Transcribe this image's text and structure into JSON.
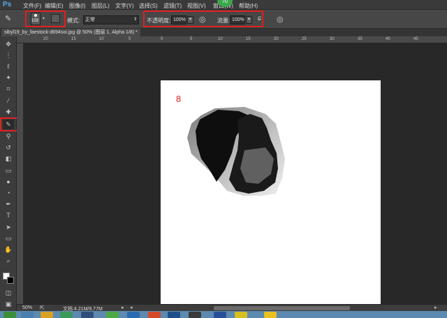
{
  "app": {
    "logo": "Ps"
  },
  "menubar": {
    "items": [
      "文件(F)",
      "编辑(E)",
      "图像(I)",
      "图层(L)",
      "文字(Y)",
      "选择(S)",
      "滤镜(T)",
      "视图(V)",
      "窗口(W)",
      "帮助(H)"
    ],
    "badge": "70"
  },
  "options": {
    "brush_size": "103",
    "mode_label": "模式:",
    "mode_value": "正常",
    "opacity_label": "不透明度:",
    "opacity_value": "100%",
    "flow_label": "流量:",
    "flow_value": "100%"
  },
  "document": {
    "tab_title": "sibyl19_by_faestock-d694soi.jpg @ 50% (图层 1, Alpha 1/8) *",
    "annotation_number": "8"
  },
  "ruler": {
    "top_ticks": [
      "20",
      "15",
      "10",
      "5",
      "0",
      "5",
      "10",
      "15",
      "20",
      "25",
      "30",
      "35",
      "40",
      "45"
    ]
  },
  "status": {
    "zoom": "50%",
    "doc_info": "文档:4.21M/9.77M"
  },
  "colors": {
    "highlight": "#e02020",
    "accent": "#3aa84a"
  }
}
